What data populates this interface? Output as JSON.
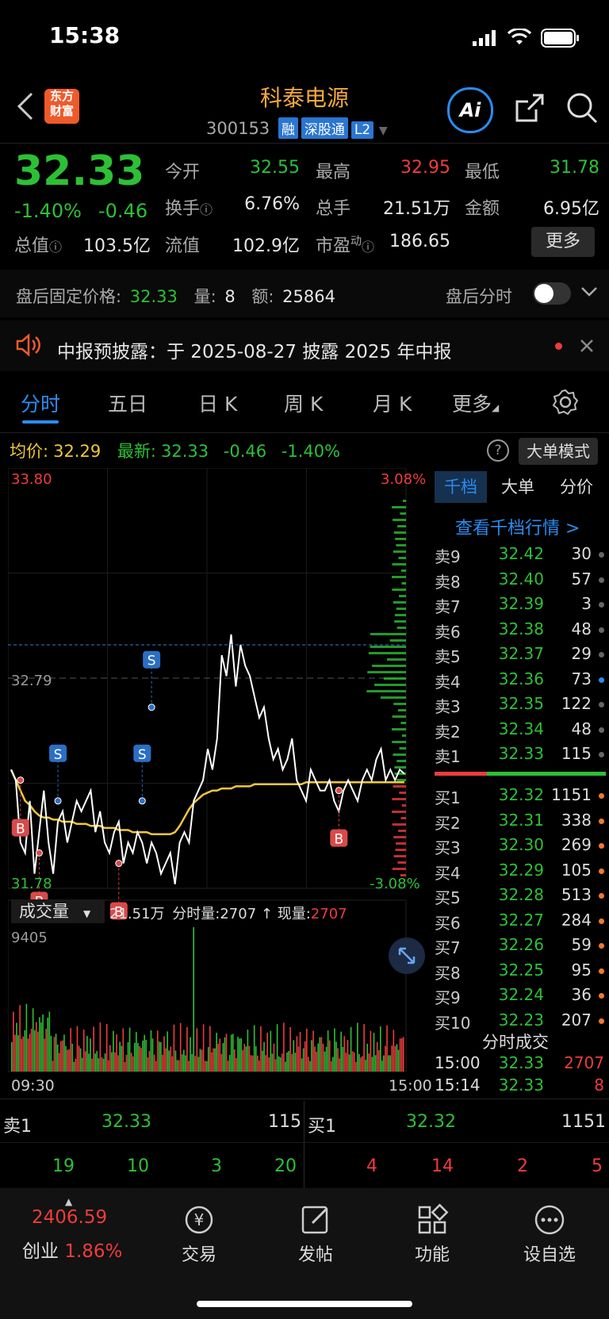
{
  "status": {
    "time": "15:38"
  },
  "header": {
    "logo_top": "东方",
    "logo_bottom": "财富",
    "name": "科泰电源",
    "code": "300153",
    "tags": [
      "融",
      "深股通",
      "L2"
    ]
  },
  "quote": {
    "price": "32.33",
    "change_pct": "-1.40%",
    "change": "-0.46",
    "open_label": "今开",
    "open": "32.55",
    "high_label": "最高",
    "high": "32.95",
    "low_label": "最低",
    "low": "31.78",
    "turnover_label": "换手",
    "turnover": "6.76%",
    "volume_label": "总手",
    "volume": "21.51万",
    "amount_label": "金额",
    "amount": "6.95亿",
    "mcap_label": "总值",
    "mcap": "103.5亿",
    "float_label": "流值",
    "float": "102.9亿",
    "pe_label": "市盈",
    "pe_sup": "动",
    "pe": "186.65",
    "more": "更多"
  },
  "after_hours": {
    "label": "盘后固定价格:",
    "price": "32.33",
    "vol_label": "量:",
    "vol": "8",
    "amt_label": "额:",
    "amt": "25864",
    "toggle_label": "盘后分时"
  },
  "notice": {
    "text": "中报预披露：于 2025-08-27 披露 2025 年中报"
  },
  "tabs": [
    "分时",
    "五日",
    "日 K",
    "周 K",
    "月 K",
    "更多"
  ],
  "info": {
    "avg_label": "均价:",
    "avg": "32.29",
    "latest_label": "最新:",
    "latest": "32.33",
    "chg": "-0.46",
    "pct": "-1.40%",
    "mode_btn": "大单模式"
  },
  "chart": {
    "y_top": "33.80",
    "y_bottom": "31.78",
    "y_mid": "32.79",
    "pct_top": "3.08%",
    "pct_bottom": "-3.08%",
    "vol_label": "成交量",
    "vol_total": "21.51万",
    "minute_vol_label": "分时量:",
    "minute_vol": "2707",
    "now_vol_label": "现量:",
    "now_vol": "2707",
    "vol_max": "9405",
    "t_start": "09:30",
    "t_end": "15:00",
    "markers": [
      "B",
      "B",
      "S",
      "B",
      "S",
      "S",
      "B"
    ]
  },
  "chart_data": {
    "type": "line",
    "ylim": [
      31.78,
      33.8
    ],
    "price_series": [
      32.35,
      32.3,
      32.0,
      31.95,
      32.2,
      31.85,
      32.05,
      32.25,
      32.0,
      31.85,
      32.1,
      32.15,
      32.0,
      32.1,
      32.2,
      32.15,
      32.2,
      32.25,
      32.05,
      32.15,
      32.0,
      31.95,
      32.05,
      32.1,
      31.9,
      32.0,
      31.95,
      32.05,
      32.0,
      31.9,
      32.0,
      31.95,
      31.85,
      31.9,
      31.95,
      31.8,
      32.0,
      32.05,
      32.0,
      32.2,
      32.25,
      32.3,
      32.45,
      32.35,
      32.5,
      32.9,
      32.8,
      33.0,
      32.75,
      32.95,
      32.85,
      32.8,
      32.7,
      32.6,
      32.65,
      32.5,
      32.4,
      32.45,
      32.35,
      32.4,
      32.5,
      32.3,
      32.25,
      32.2,
      32.35,
      32.3,
      32.25,
      32.25,
      32.3,
      32.2,
      32.15,
      32.25,
      32.3,
      32.25,
      32.2,
      32.3,
      32.35,
      32.3,
      32.4,
      32.45,
      32.3,
      32.35,
      32.3,
      32.35,
      32.33
    ],
    "avg_series": [
      32.35,
      32.3,
      32.25,
      32.2,
      32.18,
      32.15,
      32.13,
      32.12,
      32.12,
      32.11,
      32.11,
      32.1,
      32.1,
      32.1,
      32.09,
      32.09,
      32.09,
      32.08,
      32.08,
      32.08,
      32.07,
      32.07,
      32.07,
      32.06,
      32.06,
      32.06,
      32.05,
      32.05,
      32.05,
      32.05,
      32.04,
      32.04,
      32.04,
      32.04,
      32.04,
      32.05,
      32.08,
      32.12,
      32.16,
      32.19,
      32.21,
      32.23,
      32.24,
      32.25,
      32.25,
      32.26,
      32.26,
      32.26,
      32.27,
      32.27,
      32.27,
      32.27,
      32.28,
      32.28,
      32.28,
      32.28,
      32.28,
      32.28,
      32.28,
      32.28,
      32.28,
      32.28,
      32.28,
      32.29,
      32.29,
      32.29,
      32.29,
      32.29,
      32.29,
      32.29,
      32.29,
      32.29,
      32.29,
      32.29,
      32.29,
      32.29,
      32.29,
      32.29,
      32.29,
      32.29,
      32.29,
      32.29,
      32.29,
      32.29,
      32.29
    ]
  },
  "right_tabs": [
    "千档",
    "大单",
    "分价"
  ],
  "view_more": "查看千档行情 >",
  "asks": [
    {
      "l": "卖9",
      "p": "32.42",
      "v": "30"
    },
    {
      "l": "卖8",
      "p": "32.40",
      "v": "57"
    },
    {
      "l": "卖7",
      "p": "32.39",
      "v": "3"
    },
    {
      "l": "卖6",
      "p": "32.38",
      "v": "48"
    },
    {
      "l": "卖5",
      "p": "32.37",
      "v": "29"
    },
    {
      "l": "卖4",
      "p": "32.36",
      "v": "73"
    },
    {
      "l": "卖3",
      "p": "32.35",
      "v": "122"
    },
    {
      "l": "卖2",
      "p": "32.34",
      "v": "48"
    },
    {
      "l": "卖1",
      "p": "32.33",
      "v": "115"
    }
  ],
  "bids": [
    {
      "l": "买1",
      "p": "32.32",
      "v": "1151"
    },
    {
      "l": "买2",
      "p": "32.31",
      "v": "338"
    },
    {
      "l": "买3",
      "p": "32.30",
      "v": "269"
    },
    {
      "l": "买4",
      "p": "32.29",
      "v": "105"
    },
    {
      "l": "买5",
      "p": "32.28",
      "v": "513"
    },
    {
      "l": "买6",
      "p": "32.27",
      "v": "284"
    },
    {
      "l": "买7",
      "p": "32.26",
      "v": "59"
    },
    {
      "l": "买8",
      "p": "32.25",
      "v": "95"
    },
    {
      "l": "买9",
      "p": "32.24",
      "v": "36"
    },
    {
      "l": "买10",
      "p": "32.23",
      "v": "207"
    }
  ],
  "trades": {
    "title": "分时成交",
    "rows": [
      {
        "t": "15:00",
        "p": "32.33",
        "v": "2707"
      },
      {
        "t": "15:14",
        "p": "32.33",
        "v": "8"
      }
    ]
  },
  "bottom": {
    "sell_label": "卖1",
    "sell_price": "32.33",
    "sell_vol": "115",
    "buy_label": "买1",
    "buy_price": "32.32",
    "buy_vol": "1151",
    "left_nums": [
      "19",
      "10",
      "3",
      "20"
    ],
    "right_nums": [
      "4",
      "14",
      "2",
      "5"
    ]
  },
  "nav": {
    "index_value": "2406.59",
    "index_name": "创业",
    "index_pct": "1.86%",
    "items": [
      {
        "label": "交易",
        "icon": "yen-icon"
      },
      {
        "label": "发帖",
        "icon": "edit-icon"
      },
      {
        "label": "功能",
        "icon": "grid-icon"
      },
      {
        "label": "设自选",
        "icon": "more-icon"
      }
    ]
  },
  "colors": {
    "up": "#ef3c3c",
    "down": "#2dc035",
    "avg": "#f0c63a",
    "accent": "#2a8cf0",
    "name": "#f2a93b"
  }
}
